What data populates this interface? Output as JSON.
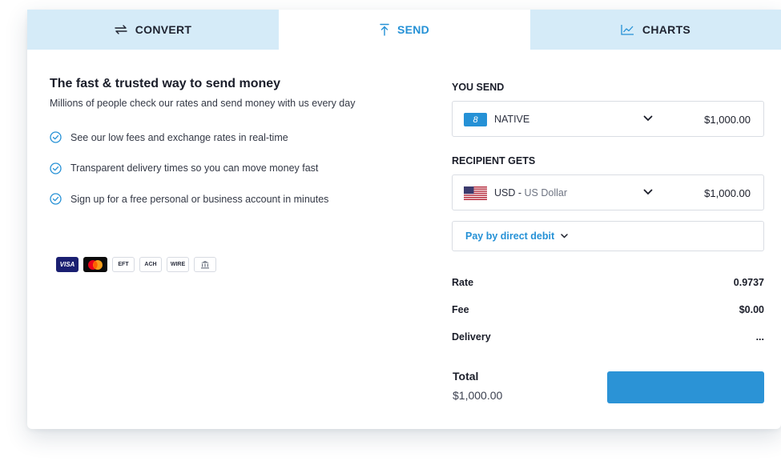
{
  "tabs": [
    {
      "label": "CONVERT",
      "icon": "swap-arrows-icon"
    },
    {
      "label": "SEND",
      "icon": "upload-arrow-icon"
    },
    {
      "label": "CHARTS",
      "icon": "line-chart-icon"
    }
  ],
  "intro": {
    "headline": "The fast & trusted way to send money",
    "subline": "Millions of people check our rates and send money with us every day",
    "features": [
      "See our low fees and exchange rates in real-time",
      "Transparent delivery times so you can move money fast",
      "Sign up for a free personal or business account in minutes"
    ]
  },
  "payment_icons": [
    {
      "name": "visa-icon",
      "label": "VISA"
    },
    {
      "name": "mastercard-icon",
      "label": ""
    },
    {
      "name": "eft-icon",
      "label": "EFT"
    },
    {
      "name": "ach-icon",
      "label": "ACH"
    },
    {
      "name": "wire-icon",
      "label": "WIRE"
    },
    {
      "name": "bank-icon",
      "label": ""
    }
  ],
  "send": {
    "label": "YOU SEND",
    "currency": "NATIVE",
    "currency_icon_char": "8",
    "amount": "$1,000.00"
  },
  "receive": {
    "label": "RECIPIENT GETS",
    "currency_code": "USD",
    "currency_name": "US Dollar",
    "amount": "$1,000.00"
  },
  "pay_method": "Pay by direct debit",
  "summary": {
    "rate_label": "Rate",
    "rate_value": "0.9737",
    "fee_label": "Fee",
    "fee_value": "$0.00",
    "delivery_label": "Delivery",
    "delivery_value": "..."
  },
  "total": {
    "label": "Total",
    "value": "$1,000.00"
  },
  "colors": {
    "accent": "#2591d6",
    "tab_bg": "#d5ebf8",
    "button": "#2b93d6"
  }
}
